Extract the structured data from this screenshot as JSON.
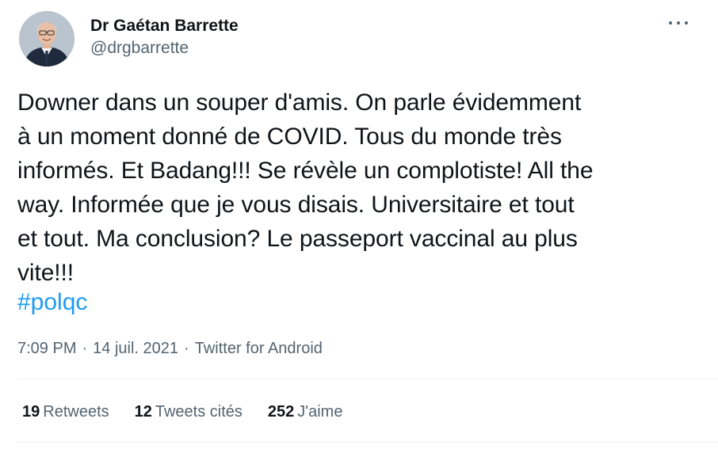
{
  "author": {
    "display_name": "Dr Gaétan Barrette",
    "handle": "@drgbarrette",
    "avatar_icon": "profile-photo"
  },
  "more_icon": "more-horizontal-icon",
  "tweet": {
    "text": "Downer dans un souper d'amis. On parle évidemment\nà un moment donné de COVID. Tous du monde très\ninformés. Et Badang!!! Se révèle un complotiste! All the\nway. Informée que je vous disais. Universitaire et tout\net tout. Ma conclusion? Le passeport vaccinal au plus\nvite!!!",
    "hashtag": "#polqc",
    "time": "7:09 PM",
    "separator": "·",
    "date": "14 juil. 2021",
    "source": "Twitter for Android"
  },
  "stats": {
    "retweets_count": "19",
    "retweets_label": "Retweets",
    "quotes_count": "12",
    "quotes_label": "Tweets cités",
    "likes_count": "252",
    "likes_label": "J'aime"
  },
  "colors": {
    "text": "#0f1419",
    "secondary": "#536471",
    "link": "#1d9bf0",
    "divider": "#eff3f4"
  }
}
